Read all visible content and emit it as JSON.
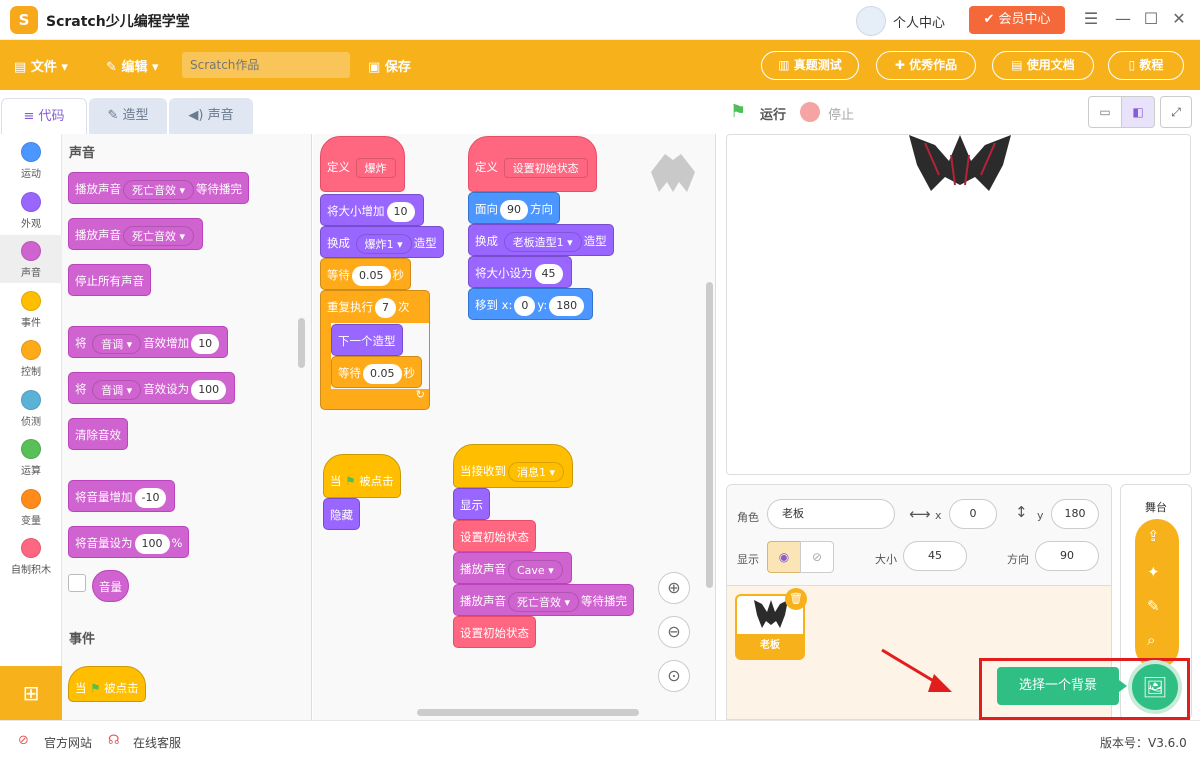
{
  "window": {
    "title": "Scratch少儿编程学堂",
    "logo_text": "S",
    "user_center": "个人中心",
    "vip_label": "会员中心"
  },
  "toolbar": {
    "file": "文件",
    "edit": "编辑",
    "search_placeholder": "Scratch作品",
    "save": "保存",
    "real_test": "真题测试",
    "excellent_works": "优秀作品",
    "docs": "使用文档",
    "tutorial": "教程"
  },
  "tabs": {
    "code": "代码",
    "costume": "造型",
    "sound": "声音"
  },
  "categories": [
    {
      "label": "运动",
      "color": "#4c97ff"
    },
    {
      "label": "外观",
      "color": "#9966ff"
    },
    {
      "label": "声音",
      "color": "#cf63cf"
    },
    {
      "label": "事件",
      "color": "#ffbf00"
    },
    {
      "label": "控制",
      "color": "#ffab19"
    },
    {
      "label": "侦测",
      "color": "#5cb1d6"
    },
    {
      "label": "运算",
      "color": "#59c059"
    },
    {
      "label": "变量",
      "color": "#ff8c1a"
    },
    {
      "label": "自制积木",
      "color": "#ff6680"
    }
  ],
  "palette": {
    "sound_title": "声音",
    "play_sound": "播放声音",
    "death_sfx": "死亡音效",
    "until_done": "等待播完",
    "stop_all": "停止所有声音",
    "set_prefix": "将",
    "pitch": "音调",
    "effect_change": "音效增加",
    "effect_set": "音效设为",
    "val_10": "10",
    "val_100": "100",
    "clear_effects": "清除音效",
    "vol_change": "将音量增加",
    "vol_change_val": "-10",
    "vol_set": "将音量设为",
    "vol_set_val": "100",
    "percent": "%",
    "volume": "音量",
    "events_title": "事件",
    "when": "当",
    "clicked": "被点击"
  },
  "scripts": {
    "define": "定义",
    "explode": "爆炸",
    "size_change": "将大小增加",
    "size_change_val": "10",
    "switch_to": "换成",
    "explode1": "爆炸1",
    "costume": "造型",
    "wait": "等待",
    "wait_val": "0.05",
    "sec": "秒",
    "repeat": "重复执行",
    "repeat_val": "7",
    "times": "次",
    "next_costume": "下一个造型",
    "init_state": "设置初始状态",
    "point_dir": "面向",
    "dir_val": "90",
    "direction": "方向",
    "boss_costume": "老板造型1",
    "size_set": "将大小设为",
    "size_set_val": "45",
    "goto": "移到 x:",
    "x_val": "0",
    "y_label": "y:",
    "y_val": "180",
    "when": "当",
    "clicked": "被点击",
    "hide": "隐藏",
    "when_receive": "当接收到",
    "message1": "消息1",
    "show": "显示",
    "play_sound": "播放声音",
    "cave": "Cave",
    "death_sfx": "死亡音效",
    "until_done": "等待播完"
  },
  "stage_controls": {
    "run": "运行",
    "stop": "停止"
  },
  "sprite_info": {
    "sprite_label": "角色",
    "sprite_name": "老板",
    "x_label": "x",
    "x_val": "0",
    "y_label": "y",
    "y_val": "180",
    "show_label": "显示",
    "size_label": "大小",
    "size_val": "45",
    "dir_label": "方向",
    "dir_val": "90"
  },
  "sprite_list": [
    {
      "name": "老板"
    }
  ],
  "stage_panel": {
    "title": "舞台",
    "choose_backdrop": "选择一个背景"
  },
  "status": {
    "website": "官方网站",
    "support": "在线客服",
    "version": "版本号：V3.6.0"
  }
}
